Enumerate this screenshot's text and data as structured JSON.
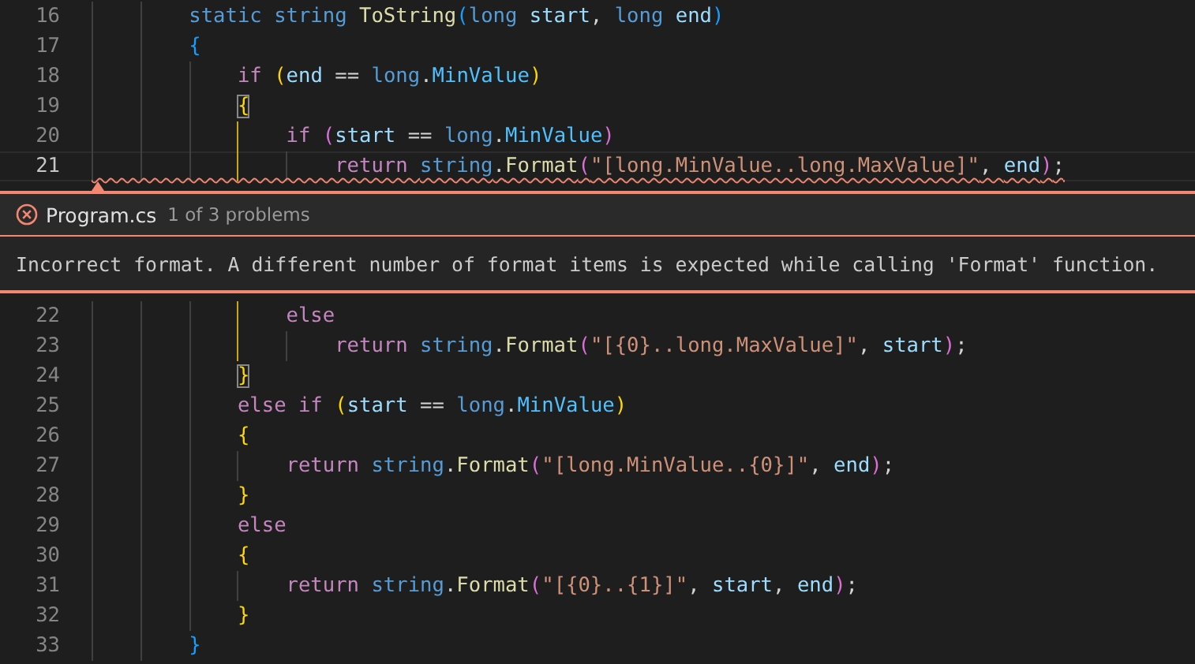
{
  "code_top": [
    {
      "number": "16",
      "current": false,
      "error": false,
      "tokens": [
        {
          "kind": "keyword",
          "text": "        static string "
        },
        {
          "kind": "func",
          "text": "ToString"
        },
        {
          "kind": "b3",
          "text": "("
        },
        {
          "kind": "keyword",
          "text": "long "
        },
        {
          "kind": "var",
          "text": "start"
        },
        {
          "kind": "plain",
          "text": ", "
        },
        {
          "kind": "keyword",
          "text": "long "
        },
        {
          "kind": "var",
          "text": "end"
        },
        {
          "kind": "b3",
          "text": ")"
        }
      ]
    },
    {
      "number": "17",
      "current": false,
      "error": false,
      "tokens": [
        {
          "kind": "b3",
          "text": "        {"
        }
      ]
    },
    {
      "number": "18",
      "current": false,
      "error": false,
      "tokens": [
        {
          "kind": "control",
          "text": "            if "
        },
        {
          "kind": "b1",
          "text": "("
        },
        {
          "kind": "var",
          "text": "end"
        },
        {
          "kind": "plain",
          "text": " == "
        },
        {
          "kind": "keyword",
          "text": "long"
        },
        {
          "kind": "plain",
          "text": "."
        },
        {
          "kind": "prop",
          "text": "MinValue"
        },
        {
          "kind": "b1",
          "text": ")"
        }
      ]
    },
    {
      "number": "19",
      "current": false,
      "error": false,
      "tokens": [
        {
          "kind": "b1",
          "text": "            {",
          "matched": true
        }
      ]
    },
    {
      "number": "20",
      "current": false,
      "error": false,
      "active_guide": true,
      "tokens": [
        {
          "kind": "control",
          "text": "                if "
        },
        {
          "kind": "b2",
          "text": "("
        },
        {
          "kind": "var",
          "text": "start"
        },
        {
          "kind": "plain",
          "text": " == "
        },
        {
          "kind": "keyword",
          "text": "long"
        },
        {
          "kind": "plain",
          "text": "."
        },
        {
          "kind": "prop",
          "text": "MinValue"
        },
        {
          "kind": "b2",
          "text": ")"
        }
      ]
    },
    {
      "number": "21",
      "current": true,
      "error": true,
      "active_guide": true,
      "tokens": [
        {
          "kind": "control",
          "text": "                    return "
        },
        {
          "kind": "keyword",
          "text": "string"
        },
        {
          "kind": "plain",
          "text": "."
        },
        {
          "kind": "func",
          "text": "Format"
        },
        {
          "kind": "b2",
          "text": "("
        },
        {
          "kind": "string",
          "text": "\"[long.MinValue..long.MaxValue]\""
        },
        {
          "kind": "plain",
          "text": ", "
        },
        {
          "kind": "var",
          "text": "end"
        },
        {
          "kind": "b2",
          "text": ")"
        },
        {
          "kind": "plain",
          "text": ";"
        }
      ]
    }
  ],
  "problem_peek": {
    "file": "Program.cs",
    "count": "1 of 3 problems",
    "message": "Incorrect format. A different number of format items is expected while calling 'Format' function."
  },
  "code_bottom": [
    {
      "number": "22",
      "current": false,
      "error": false,
      "active_guide": true,
      "tokens": [
        {
          "kind": "control",
          "text": "                else"
        }
      ]
    },
    {
      "number": "23",
      "current": false,
      "error": false,
      "active_guide": true,
      "tokens": [
        {
          "kind": "control",
          "text": "                    return "
        },
        {
          "kind": "keyword",
          "text": "string"
        },
        {
          "kind": "plain",
          "text": "."
        },
        {
          "kind": "func",
          "text": "Format"
        },
        {
          "kind": "b2",
          "text": "("
        },
        {
          "kind": "string",
          "text": "\"[{0}..long.MaxValue]\""
        },
        {
          "kind": "plain",
          "text": ", "
        },
        {
          "kind": "var",
          "text": "start"
        },
        {
          "kind": "b2",
          "text": ")"
        },
        {
          "kind": "plain",
          "text": ";"
        }
      ]
    },
    {
      "number": "24",
      "current": false,
      "error": false,
      "tokens": [
        {
          "kind": "b1",
          "text": "            }",
          "matched": true
        }
      ]
    },
    {
      "number": "25",
      "current": false,
      "error": false,
      "tokens": [
        {
          "kind": "control",
          "text": "            else if "
        },
        {
          "kind": "b1",
          "text": "("
        },
        {
          "kind": "var",
          "text": "start"
        },
        {
          "kind": "plain",
          "text": " == "
        },
        {
          "kind": "keyword",
          "text": "long"
        },
        {
          "kind": "plain",
          "text": "."
        },
        {
          "kind": "prop",
          "text": "MinValue"
        },
        {
          "kind": "b1",
          "text": ")"
        }
      ]
    },
    {
      "number": "26",
      "current": false,
      "error": false,
      "tokens": [
        {
          "kind": "b1",
          "text": "            {"
        }
      ]
    },
    {
      "number": "27",
      "current": false,
      "error": false,
      "active_guide": false,
      "tokens": [
        {
          "kind": "control",
          "text": "                return "
        },
        {
          "kind": "keyword",
          "text": "string"
        },
        {
          "kind": "plain",
          "text": "."
        },
        {
          "kind": "func",
          "text": "Format"
        },
        {
          "kind": "b2",
          "text": "("
        },
        {
          "kind": "string",
          "text": "\"[long.MinValue..{0}]\""
        },
        {
          "kind": "plain",
          "text": ", "
        },
        {
          "kind": "var",
          "text": "end"
        },
        {
          "kind": "b2",
          "text": ")"
        },
        {
          "kind": "plain",
          "text": ";"
        }
      ]
    },
    {
      "number": "28",
      "current": false,
      "error": false,
      "tokens": [
        {
          "kind": "b1",
          "text": "            }"
        }
      ]
    },
    {
      "number": "29",
      "current": false,
      "error": false,
      "tokens": [
        {
          "kind": "control",
          "text": "            else"
        }
      ]
    },
    {
      "number": "30",
      "current": false,
      "error": false,
      "tokens": [
        {
          "kind": "b1",
          "text": "            {"
        }
      ]
    },
    {
      "number": "31",
      "current": false,
      "error": false,
      "active_guide": false,
      "tokens": [
        {
          "kind": "control",
          "text": "                return "
        },
        {
          "kind": "keyword",
          "text": "string"
        },
        {
          "kind": "plain",
          "text": "."
        },
        {
          "kind": "func",
          "text": "Format"
        },
        {
          "kind": "b2",
          "text": "("
        },
        {
          "kind": "string",
          "text": "\"[{0}..{1}]\""
        },
        {
          "kind": "plain",
          "text": ", "
        },
        {
          "kind": "var",
          "text": "start"
        },
        {
          "kind": "plain",
          "text": ", "
        },
        {
          "kind": "var",
          "text": "end"
        },
        {
          "kind": "b2",
          "text": ")"
        },
        {
          "kind": "plain",
          "text": ";"
        }
      ]
    },
    {
      "number": "32",
      "current": false,
      "error": false,
      "tokens": [
        {
          "kind": "b1",
          "text": "            }"
        }
      ]
    },
    {
      "number": "33",
      "current": false,
      "error": false,
      "tokens": [
        {
          "kind": "b3",
          "text": "        }"
        }
      ]
    }
  ]
}
